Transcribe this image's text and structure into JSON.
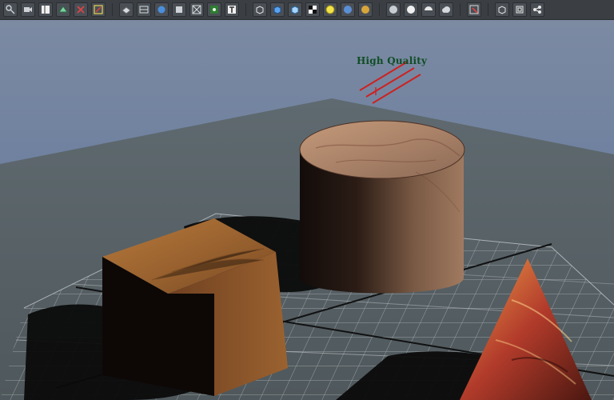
{
  "viewport": {
    "hq_label": "High Quality"
  },
  "toolbar": {
    "icons": [
      "scale-tool-icon",
      "select-camera-icon",
      "bookmark-icon",
      "image-plane-icon",
      "2d-pan-zoom-icon",
      "grease-pencil-icon",
      "shaded-icon",
      "wireframe-icon",
      "smooth-shade-icon",
      "wireframe-on-shaded-icon",
      "xray-icon",
      "textured-icon",
      "text-icon",
      "cube-wireframe-icon",
      "cube-shaded-icon",
      "cube-flat-icon",
      "checker-icon",
      "light-sphere-icon",
      "ambient-occlusion-icon",
      "sphere-lit-icon",
      "sphere-gray-icon",
      "sphere-white-icon",
      "half-sphere-icon",
      "cloud-icon",
      "camera-select-icon",
      "cube-outline-icon",
      "cube-window-icon",
      "share-icon"
    ]
  },
  "colors": {
    "toolbar_bg": "#3b3f44",
    "sky_top": "#7c8aa2",
    "plane": "#5a6468",
    "grid": "#c8ccd0",
    "hq_text": "#0f4d24",
    "light_red": "#cc2222"
  }
}
